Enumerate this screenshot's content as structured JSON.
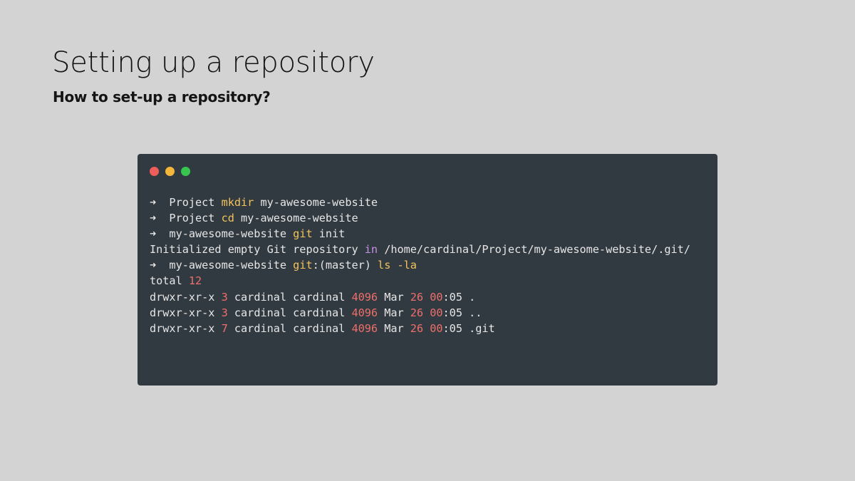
{
  "slide": {
    "title": "Setting up a repository",
    "subtitle": "How to set-up a repository?"
  },
  "terminal": {
    "window_controls": [
      {
        "name": "close",
        "color": "#ee5d5a"
      },
      {
        "name": "minimize",
        "color": "#f6b63a"
      },
      {
        "name": "maximize",
        "color": "#38c64f"
      }
    ],
    "colors": {
      "background": "#323a41",
      "text": "#e6e6e6",
      "command": "#f2c35a",
      "keyword": "#c690e6",
      "number": "#ee6f6a"
    },
    "lines": [
      [
        {
          "text": "➜  Project ",
          "color": "text"
        },
        {
          "text": "mkdir",
          "color": "command"
        },
        {
          "text": " my-awesome-website",
          "color": "text"
        }
      ],
      [
        {
          "text": "➜  Project ",
          "color": "text"
        },
        {
          "text": "cd",
          "color": "command"
        },
        {
          "text": " my-awesome-website",
          "color": "text"
        }
      ],
      [
        {
          "text": "➜  my-awesome-website ",
          "color": "text"
        },
        {
          "text": "git",
          "color": "command"
        },
        {
          "text": " init",
          "color": "text"
        }
      ],
      [
        {
          "text": "Initialized empty Git repository ",
          "color": "text"
        },
        {
          "text": "in",
          "color": "keyword"
        },
        {
          "text": " /home/cardinal/Project/my-awesome-website/.git/",
          "color": "text"
        }
      ],
      [
        {
          "text": "➜  my-awesome-website ",
          "color": "text"
        },
        {
          "text": "git",
          "color": "command"
        },
        {
          "text": ":(master) ",
          "color": "text"
        },
        {
          "text": "ls -la",
          "color": "command"
        }
      ],
      [
        {
          "text": "total ",
          "color": "text"
        },
        {
          "text": "12",
          "color": "number"
        }
      ],
      [
        {
          "text": "drwxr-xr-x ",
          "color": "text"
        },
        {
          "text": "3",
          "color": "number"
        },
        {
          "text": " cardinal cardinal ",
          "color": "text"
        },
        {
          "text": "4096",
          "color": "number"
        },
        {
          "text": " Mar ",
          "color": "text"
        },
        {
          "text": "26",
          "color": "number"
        },
        {
          "text": " ",
          "color": "text"
        },
        {
          "text": "00",
          "color": "number"
        },
        {
          "text": ":05 .",
          "color": "text"
        }
      ],
      [
        {
          "text": "drwxr-xr-x ",
          "color": "text"
        },
        {
          "text": "3",
          "color": "number"
        },
        {
          "text": " cardinal cardinal ",
          "color": "text"
        },
        {
          "text": "4096",
          "color": "number"
        },
        {
          "text": " Mar ",
          "color": "text"
        },
        {
          "text": "26",
          "color": "number"
        },
        {
          "text": " ",
          "color": "text"
        },
        {
          "text": "00",
          "color": "number"
        },
        {
          "text": ":05 ..",
          "color": "text"
        }
      ],
      [
        {
          "text": "drwxr-xr-x ",
          "color": "text"
        },
        {
          "text": "7",
          "color": "number"
        },
        {
          "text": " cardinal cardinal ",
          "color": "text"
        },
        {
          "text": "4096",
          "color": "number"
        },
        {
          "text": " Mar ",
          "color": "text"
        },
        {
          "text": "26",
          "color": "number"
        },
        {
          "text": " ",
          "color": "text"
        },
        {
          "text": "00",
          "color": "number"
        },
        {
          "text": ":05 .git",
          "color": "text"
        }
      ]
    ]
  }
}
